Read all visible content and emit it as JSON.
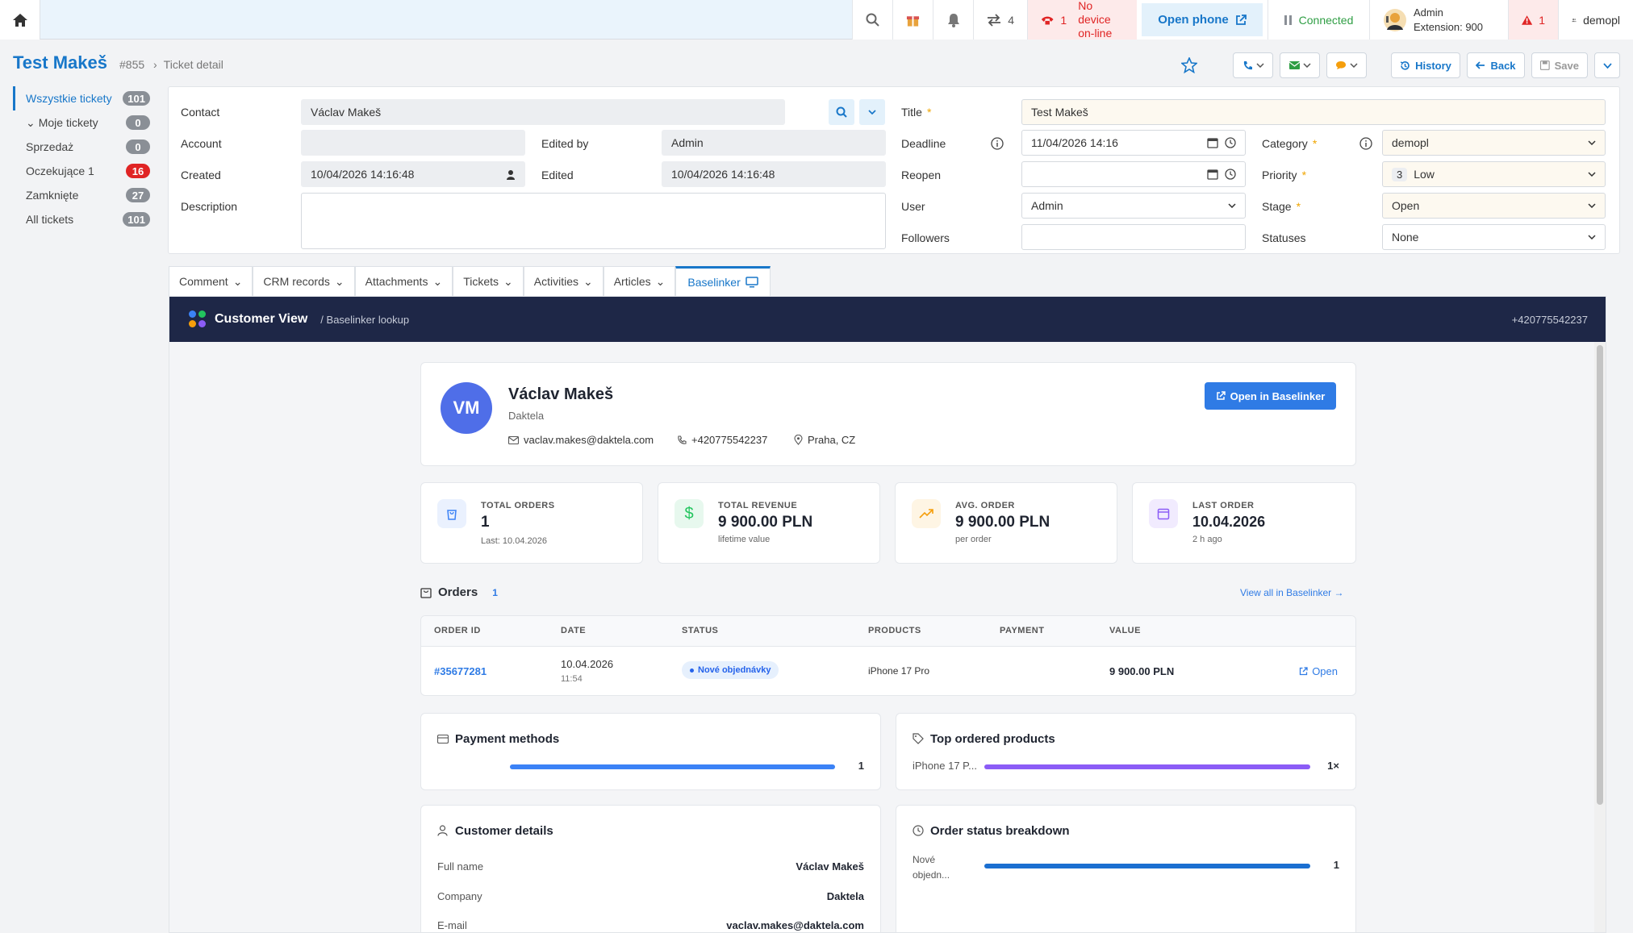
{
  "topbar": {
    "transfers_count": "4",
    "no_device_count": "1",
    "no_device_text": [
      "No device",
      "on-line"
    ],
    "open_phone": "Open phone",
    "status": "Connected",
    "agent_name": "Admin",
    "agent_extension": "Extension: 900",
    "alert_count": "1",
    "user": "demopl"
  },
  "header": {
    "title": "Test Makeš",
    "number": "#855",
    "breadcrumb": "Ticket detail",
    "history": "History",
    "back": "Back",
    "save": "Save"
  },
  "sidebar": {
    "items": [
      {
        "label": "Wszystkie tickety",
        "count": "101"
      },
      {
        "label": "Moje tickety",
        "count": "0"
      },
      {
        "label": "Sprzedaż",
        "count": "0"
      },
      {
        "label": "Oczekujące 1",
        "count": "16"
      },
      {
        "label": "Zamknięte",
        "count": "27"
      },
      {
        "label": "All tickets",
        "count": "101"
      }
    ]
  },
  "form": {
    "contact_label": "Contact",
    "contact_value": "Václav Makeš",
    "account_label": "Account",
    "account_value": "",
    "edited_by_label": "Edited by",
    "edited_by_value": "Admin",
    "created_label": "Created",
    "created_value": "10/04/2026 14:16:48",
    "edited_label": "Edited",
    "edited_value": "10/04/2026 14:16:48",
    "description_label": "Description",
    "title_label": "Title",
    "title_value": "Test Makeš",
    "deadline_label": "Deadline",
    "deadline_value": "11/04/2026 14:16",
    "reopen_label": "Reopen",
    "reopen_value": "",
    "user_label": "User",
    "user_value": "Admin",
    "followers_label": "Followers",
    "category_label": "Category",
    "category_value": "demopl",
    "priority_label": "Priority",
    "priority_num": "3",
    "priority_value": "Low",
    "stage_label": "Stage",
    "stage_value": "Open",
    "statuses_label": "Statuses",
    "statuses_value": "None"
  },
  "tabs": [
    "Comment",
    "CRM records",
    "Attachments",
    "Tickets",
    "Activities",
    "Articles",
    "Baselinker"
  ],
  "customer_view": {
    "title": "Customer View",
    "subtitle": "/ Baselinker lookup",
    "phone": "+420775542237",
    "initials": "VM",
    "name": "Václav Makeš",
    "company": "Daktela",
    "email": "vaclav.makes@daktela.com",
    "phone_contact": "+420775542237",
    "location": "Praha, CZ",
    "open_button": "Open in Baselinker"
  },
  "stats": [
    {
      "label": "TOTAL ORDERS",
      "value": "1",
      "sub": "Last: 10.04.2026",
      "color": "#3b82f6"
    },
    {
      "label": "TOTAL REVENUE",
      "value": "9 900.00 PLN",
      "sub": "lifetime value",
      "color": "#22c55e"
    },
    {
      "label": "AVG. ORDER",
      "value": "9 900.00 PLN",
      "sub": "per order",
      "color": "#f59e0b"
    },
    {
      "label": "LAST ORDER",
      "value": "10.04.2026",
      "sub": "2 h ago",
      "color": "#8b5cf6"
    }
  ],
  "orders": {
    "title": "Orders",
    "count": "1",
    "view_all": "View all in Baselinker →",
    "columns": [
      "ORDER ID",
      "DATE",
      "STATUS",
      "PRODUCTS",
      "PAYMENT",
      "VALUE"
    ],
    "rows": [
      {
        "id": "#35677281",
        "date": "10.04.2026",
        "time": "11:54",
        "status": "Nové objednávky",
        "products": "iPhone 17 Pro",
        "payment": "",
        "value": "9 900.00 PLN",
        "action": "Open"
      }
    ]
  },
  "payment_methods": {
    "title": "Payment methods",
    "rows": [
      {
        "label": "",
        "value": 1,
        "value_text": "1"
      }
    ]
  },
  "top_products": {
    "title": "Top ordered products",
    "rows": [
      {
        "label": "iPhone 17 P...",
        "value": 1,
        "value_text": "1×"
      }
    ]
  },
  "customer_details": {
    "title": "Customer details",
    "rows": [
      {
        "label": "Full name",
        "value": "Václav Makeš"
      },
      {
        "label": "Company",
        "value": "Daktela"
      },
      {
        "label": "E-mail",
        "value": "vaclav.makes@daktela.com"
      }
    ]
  },
  "status_breakdown": {
    "title": "Order status breakdown",
    "rows": [
      {
        "label": [
          "Nové",
          "objedn..."
        ],
        "value": 1,
        "value_text": "1"
      }
    ]
  }
}
